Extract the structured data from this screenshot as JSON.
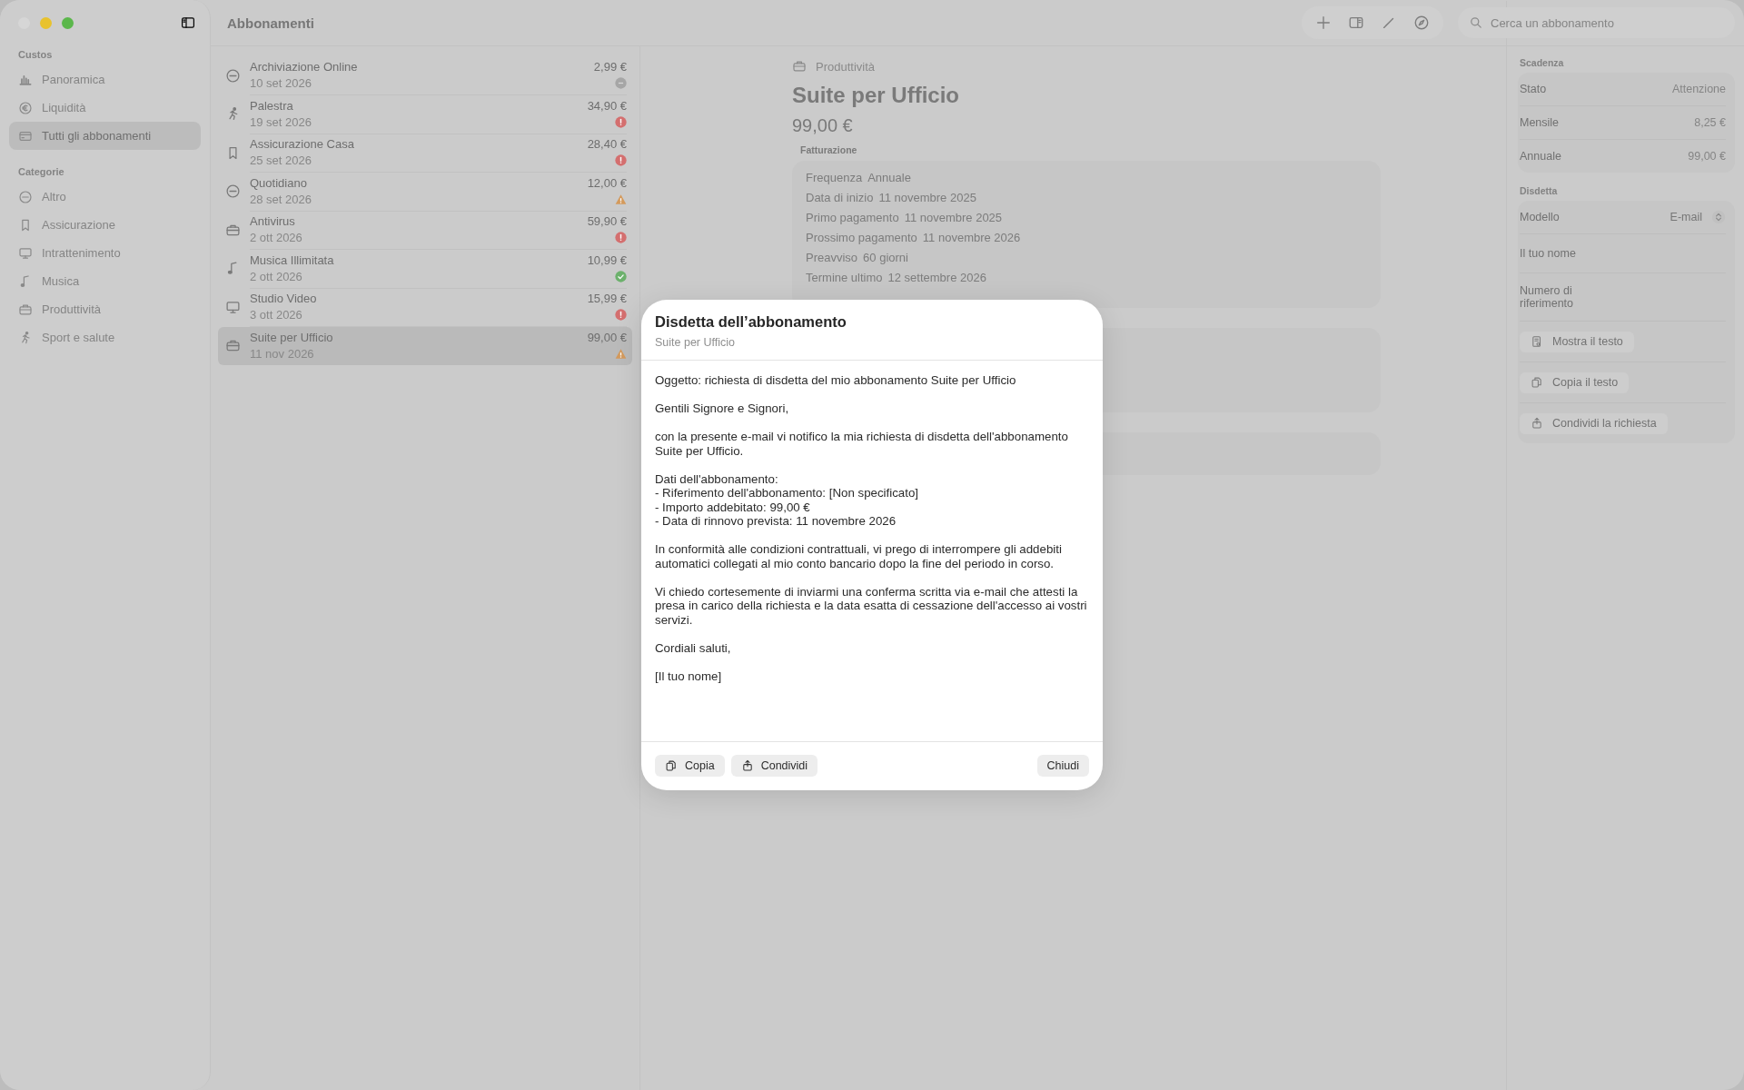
{
  "window": {
    "title": "Abbonamenti"
  },
  "sidebar": {
    "sections": [
      {
        "title": "Custos",
        "items": [
          {
            "label": "Panoramica",
            "selected": false
          },
          {
            "label": "Liquidità",
            "selected": false
          },
          {
            "label": "Tutti gli abbonamenti",
            "selected": true
          }
        ]
      },
      {
        "title": "Categorie",
        "items": [
          {
            "label": "Altro",
            "selected": false
          },
          {
            "label": "Assicurazione",
            "selected": false
          },
          {
            "label": "Intrattenimento",
            "selected": false
          },
          {
            "label": "Musica",
            "selected": false
          },
          {
            "label": "Produttività",
            "selected": false
          },
          {
            "label": "Sport e salute",
            "selected": false
          }
        ]
      }
    ]
  },
  "list": {
    "rows": [
      {
        "name": "Archiviazione Online",
        "date": "10 set 2026",
        "amount": "2,99 €",
        "kind": "neutral",
        "selected": false
      },
      {
        "name": "Palestra",
        "date": "19 set 2026",
        "amount": "34,90 €",
        "kind": "overdue",
        "selected": false
      },
      {
        "name": "Assicurazione Casa",
        "date": "25 set 2026",
        "amount": "28,40 €",
        "kind": "overdue",
        "selected": false
      },
      {
        "name": "Quotidiano",
        "date": "28 set 2026",
        "amount": "12,00 €",
        "kind": "warning",
        "selected": false
      },
      {
        "name": "Antivirus",
        "date": "2 ott 2026",
        "amount": "59,90 €",
        "kind": "overdue",
        "selected": false
      },
      {
        "name": "Musica Illimitata",
        "date": "2 ott 2026",
        "amount": "10,99 €",
        "kind": "ok",
        "selected": false
      },
      {
        "name": "Studio Video",
        "date": "3 ott 2026",
        "amount": "15,99 €",
        "kind": "overdue",
        "selected": false
      },
      {
        "name": "Suite per Ufficio",
        "date": "11 nov 2026",
        "amount": "99,00 €",
        "kind": "warning",
        "selected": true
      }
    ]
  },
  "toolbar": {
    "search": {
      "placeholder": "Cerca un abbonamento"
    }
  },
  "detail": {
    "category": "Produttività",
    "title": "Suite per Ufficio",
    "price": "99,00 €",
    "section": "Fatturazione",
    "fields": [
      {
        "label": "Frequenza",
        "value": "Annuale"
      },
      {
        "label": "Data di inizio",
        "value": "11 novembre 2025"
      },
      {
        "label": "Primo pagamento",
        "value": "11 novembre 2025"
      },
      {
        "label": "Prossimo pagamento",
        "value": "11 novembre 2026"
      },
      {
        "label": "Preavviso",
        "value": "60 giorni"
      },
      {
        "label": "Termine ultimo",
        "value": "12 settembre 2026"
      }
    ]
  },
  "inspector": {
    "sections": [
      {
        "title": "Scadenza",
        "rows": [
          {
            "kind": "value",
            "label": "Stato",
            "value": "Attenzione"
          },
          {
            "kind": "value",
            "label": "Mensile",
            "value": "8,25 €"
          },
          {
            "kind": "value",
            "label": "Annuale",
            "value": "99,00 €"
          }
        ]
      },
      {
        "title": "Disdetta",
        "rows": [
          {
            "kind": "popup",
            "label": "Modello",
            "value": "E-mail"
          },
          {
            "kind": "field",
            "label": "Il tuo nome"
          },
          {
            "kind": "field",
            "label": "Numero di riferimento"
          },
          {
            "kind": "button",
            "label": "Mostra il testo"
          },
          {
            "kind": "button",
            "label": "Copia il testo"
          },
          {
            "kind": "button",
            "label": "Condividi la richiesta"
          }
        ]
      }
    ]
  },
  "dialog": {
    "title": "Disdetta dell’abbonamento",
    "subtitle": "Suite per Ufficio",
    "paragraphs": [
      "Oggetto: richiesta di disdetta del mio abbonamento Suite per Ufficio",
      "Gentili Signore e Signori,",
      "con la presente e-mail vi notifico la mia richiesta di disdetta dell'abbonamento Suite per Ufficio.",
      "Dati dell'abbonamento:\n- Riferimento dell'abbonamento: [Non specificato]\n- Importo addebitato: 99,00 €\n- Data di rinnovo prevista: 11 novembre 2026",
      "In conformità alle condizioni contrattuali, vi prego di interrompere gli addebiti automatici collegati al mio conto bancario dopo la fine del periodo in corso.",
      "Vi chiedo cortesemente di inviarmi una conferma scritta via e-mail che attesti la presa in carico della richiesta e la data esatta di cessazione dell'accesso ai vostri servizi.",
      "Cordiali saluti,",
      "[Il tuo nome]"
    ],
    "buttons": [
      {
        "label": "Copia",
        "kind": "copy"
      },
      {
        "label": "Condividi",
        "kind": "share"
      },
      {
        "label": "Chiudi",
        "kind": "close"
      }
    ]
  }
}
